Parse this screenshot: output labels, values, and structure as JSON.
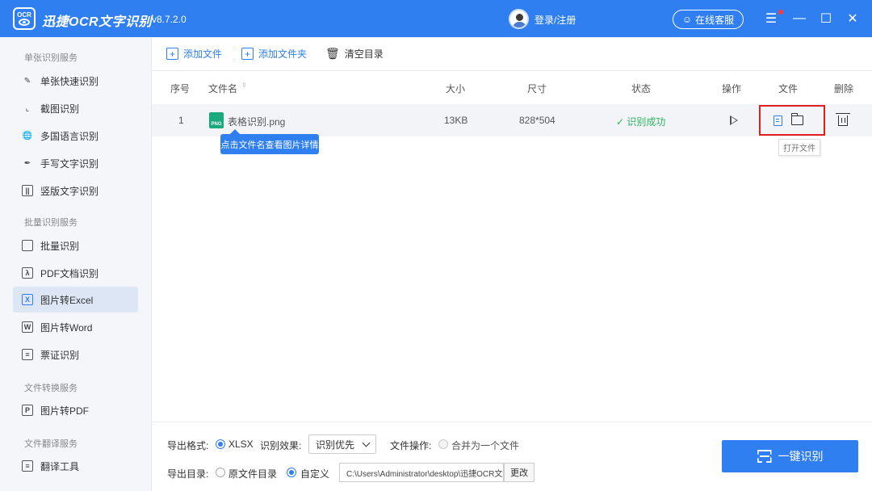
{
  "app": {
    "name": "迅捷OCR文字识别",
    "version": "v8.7.2.0",
    "logo_text": "OCR"
  },
  "header": {
    "login": "登录/注册",
    "service": "在线客服",
    "menu_icon": "menu-icon",
    "minimize_icon": "minimize-icon",
    "maximize_icon": "maximize-icon",
    "close_icon": "close-icon"
  },
  "colors": {
    "accent": "#2f7ff0",
    "success": "#2db55d",
    "highlight": "#e02020"
  },
  "sidebar": {
    "groups": [
      {
        "title": "单张识别服务",
        "items": [
          "单张快速识别",
          "截图识别",
          "多国语言识别",
          "手写文字识别",
          "竖版文字识别"
        ]
      },
      {
        "title": "批量识别服务",
        "items": [
          "批量识别",
          "PDF文档识别",
          "图片转Excel",
          "图片转Word",
          "票证识别"
        ]
      },
      {
        "title": "文件转换服务",
        "items": [
          "图片转PDF"
        ]
      },
      {
        "title": "文件翻译服务",
        "items": [
          "翻译工具"
        ]
      }
    ],
    "active": "图片转Excel"
  },
  "toolbar": {
    "add_file": "添加文件",
    "add_folder": "添加文件夹",
    "clear": "清空目录"
  },
  "table": {
    "columns": [
      "序号",
      "文件名",
      "大小",
      "尺寸",
      "状态",
      "操作",
      "文件",
      "删除"
    ],
    "rows": [
      {
        "index": "1",
        "name": "表格识别.png",
        "file_type": "PNG",
        "size": "13KB",
        "dimensions": "828*504",
        "status": "识别成功"
      }
    ]
  },
  "tooltips": {
    "filename_hint": "点击文件名查看图片详情",
    "open_file": "打开文件"
  },
  "bottom": {
    "export_format_label": "导出格式:",
    "export_format_value": "XLSX",
    "effect_label": "识别效果:",
    "effect_value": "识别优先",
    "file_op_label": "文件操作:",
    "merge_option": "合并为一个文件",
    "export_dir_label": "导出目录:",
    "dir_original": "原文件目录",
    "dir_custom": "自定义",
    "path": "C:\\Users\\Administrator\\desktop\\迅捷OCR文",
    "change": "更改",
    "run": "一键识别"
  }
}
